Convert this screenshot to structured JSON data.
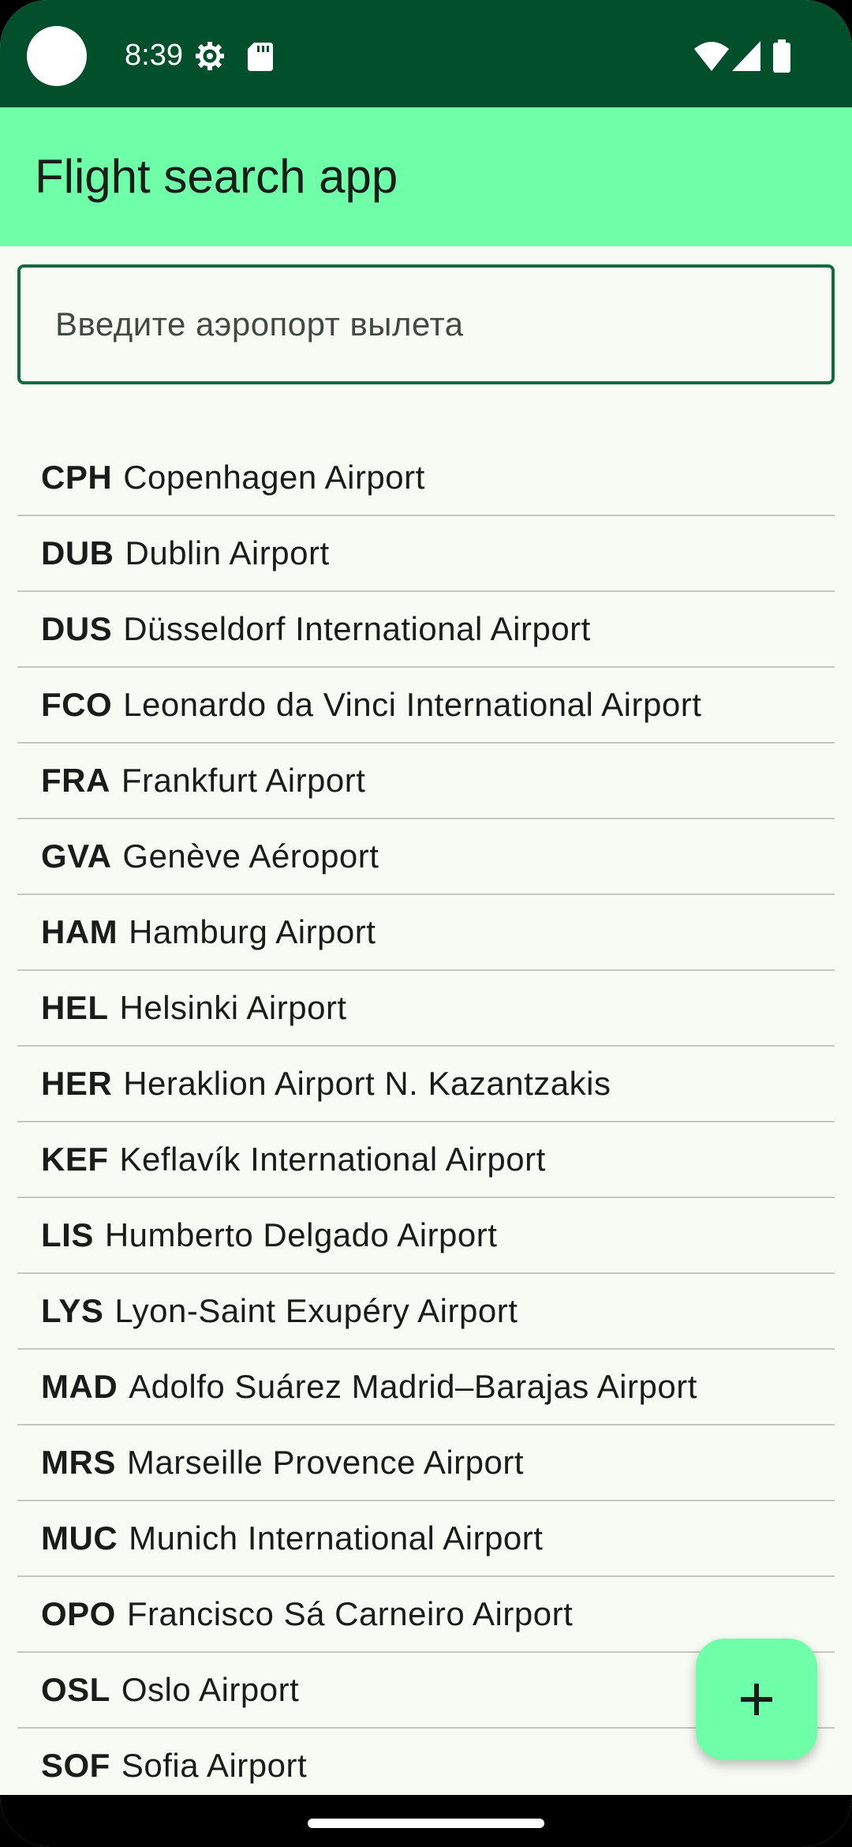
{
  "status_bar": {
    "time": "8:39",
    "icons": [
      "settings-gear-icon",
      "sd-card-icon",
      "wifi-icon",
      "cellular-signal-icon",
      "battery-icon"
    ]
  },
  "app_bar": {
    "title": "Flight search app",
    "background": "#6effa8"
  },
  "search": {
    "placeholder": "Введите аэропорт вылета",
    "value": "",
    "border_color": "#126b3e"
  },
  "airports": [
    {
      "code": "CPH",
      "name": "Copenhagen Airport"
    },
    {
      "code": "DUB",
      "name": "Dublin Airport"
    },
    {
      "code": "DUS",
      "name": "Düsseldorf International Airport"
    },
    {
      "code": "FCO",
      "name": "Leonardo da Vinci International Airport"
    },
    {
      "code": "FRA",
      "name": "Frankfurt Airport"
    },
    {
      "code": "GVA",
      "name": "Genève Aéroport"
    },
    {
      "code": "HAM",
      "name": "Hamburg Airport"
    },
    {
      "code": "HEL",
      "name": "Helsinki Airport"
    },
    {
      "code": "HER",
      "name": "Heraklion Airport N. Kazantzakis"
    },
    {
      "code": "KEF",
      "name": "Keflavík International Airport"
    },
    {
      "code": "LIS",
      "name": "Humberto Delgado Airport"
    },
    {
      "code": "LYS",
      "name": "Lyon-Saint Exupéry Airport"
    },
    {
      "code": "MAD",
      "name": "Adolfo Suárez Madrid–Barajas Airport"
    },
    {
      "code": "MRS",
      "name": "Marseille Provence Airport"
    },
    {
      "code": "MUC",
      "name": "Munich International Airport"
    },
    {
      "code": "OPO",
      "name": "Francisco Sá Carneiro Airport"
    },
    {
      "code": "OSL",
      "name": "Oslo Airport"
    },
    {
      "code": "SOF",
      "name": "Sofia Airport"
    }
  ],
  "fab": {
    "icon": "plus-icon",
    "background": "#6effa8"
  },
  "colors": {
    "status_bar": "#024f2c",
    "page_background": "#f8faf4",
    "divider": "#c2c8bf",
    "text": "#1a1c19"
  }
}
